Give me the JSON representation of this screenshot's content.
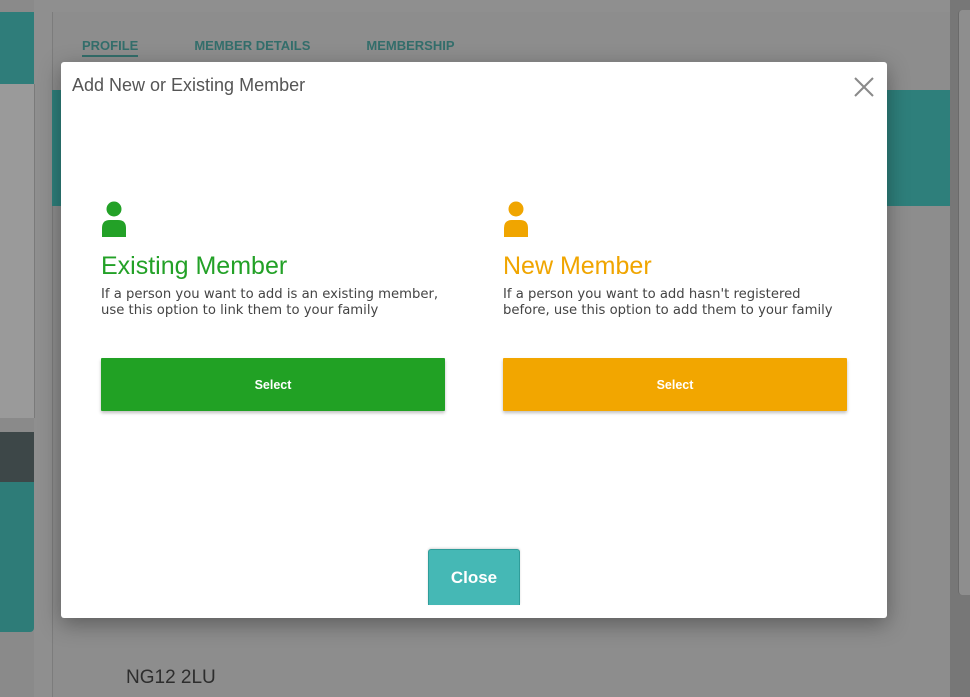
{
  "background": {
    "tabs": [
      {
        "label": "PROFILE"
      },
      {
        "label": "MEMBER DETAILS"
      },
      {
        "label": "MEMBERSHIP"
      }
    ],
    "postcode": "NG12 2LU"
  },
  "modal": {
    "title": "Add New or Existing Member",
    "close_icon": "close-icon",
    "options": {
      "existing": {
        "icon": "person-icon",
        "color": "#23a127",
        "title": "Existing Member",
        "description": "If a person you want to add is an existing member, use this option to link them to your family",
        "button_label": "Select"
      },
      "new": {
        "icon": "person-icon",
        "color": "#f0a500",
        "title": "New Member",
        "description": "If a person you want to add hasn't registered before, use this option to add them to your family",
        "button_label": "Select"
      }
    },
    "close_button_label": "Close",
    "close_button_color": "#45b8b5"
  }
}
